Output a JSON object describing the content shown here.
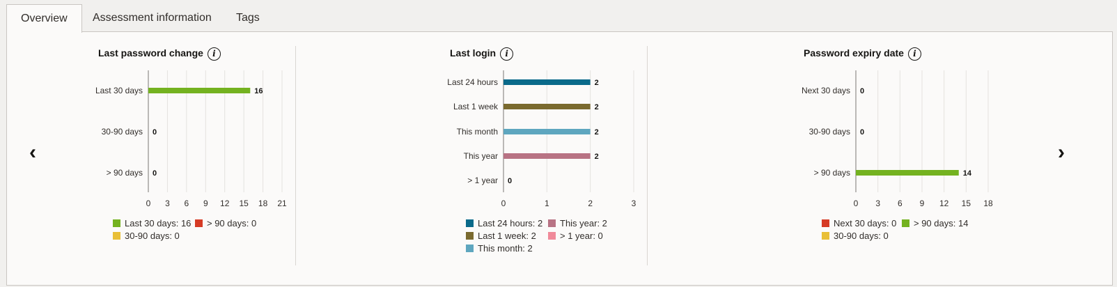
{
  "tabs": [
    {
      "label": "Overview",
      "active": true
    },
    {
      "label": "Assessment information",
      "active": false
    },
    {
      "label": "Tags",
      "active": false
    }
  ],
  "nav": {
    "prev": "‹",
    "next": "›"
  },
  "info_glyph": "i",
  "charts": [
    {
      "title": "Last password change",
      "chart_data": {
        "type": "bar",
        "orientation": "horizontal",
        "categories": [
          "Last 30 days",
          "30-90 days",
          "> 90 days"
        ],
        "values": [
          16,
          0,
          0
        ],
        "colors": [
          "#74b220",
          "#e9bf37",
          "#d63b25"
        ],
        "xticks": [
          0,
          3,
          6,
          9,
          12,
          15,
          18,
          21
        ],
        "xlim": [
          0,
          21
        ],
        "grid": true
      },
      "legend": [
        {
          "label": "Last 30 days: 16",
          "color": "#74b220"
        },
        {
          "label": "> 90 days: 0",
          "color": "#d63b25"
        },
        {
          "label": "30-90 days: 0",
          "color": "#e9bf37"
        }
      ]
    },
    {
      "title": "Last login",
      "chart_data": {
        "type": "bar",
        "orientation": "horizontal",
        "categories": [
          "Last 24 hours",
          "Last 1 week",
          "This month",
          "This year",
          "> 1 year"
        ],
        "values": [
          2,
          2,
          2,
          2,
          0
        ],
        "colors": [
          "#0a6a8a",
          "#7a6a2f",
          "#5ea6bf",
          "#b87384",
          "#f08a9a"
        ],
        "xticks": [
          0,
          1,
          2,
          3
        ],
        "xlim": [
          0,
          3
        ],
        "grid": true
      },
      "legend": [
        {
          "label": "Last 24 hours: 2",
          "color": "#0a6a8a"
        },
        {
          "label": "This year: 2",
          "color": "#b87384"
        },
        {
          "label": "Last 1 week: 2",
          "color": "#7a6a2f"
        },
        {
          "label": "> 1 year: 0",
          "color": "#f08a9a"
        },
        {
          "label": "This month: 2",
          "color": "#5ea6bf"
        }
      ]
    },
    {
      "title": "Password expiry date",
      "chart_data": {
        "type": "bar",
        "orientation": "horizontal",
        "categories": [
          "Next 30 days",
          "30-90 days",
          "> 90 days"
        ],
        "values": [
          0,
          0,
          14
        ],
        "colors": [
          "#d63b25",
          "#e9bf37",
          "#74b220"
        ],
        "xticks": [
          0,
          3,
          6,
          9,
          12,
          15,
          18
        ],
        "xlim": [
          0,
          18
        ],
        "grid": true
      },
      "legend": [
        {
          "label": "Next 30 days: 0",
          "color": "#d63b25"
        },
        {
          "label": "> 90 days: 14",
          "color": "#74b220"
        },
        {
          "label": "30-90 days: 0",
          "color": "#e9bf37"
        }
      ]
    }
  ]
}
